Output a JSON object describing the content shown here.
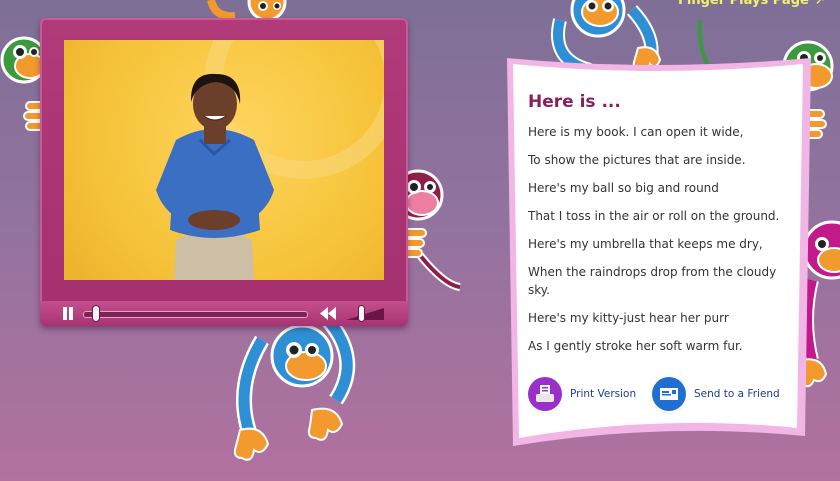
{
  "header": {
    "finger_plays_link": "Finger Plays Page"
  },
  "card": {
    "title": "Here is ...",
    "lines": [
      "Here is my book. I can open it wide,",
      "To show the pictures that are inside.",
      "Here's my ball so big and round",
      "That I toss in the air or roll on the ground.",
      "Here's my umbrella that keeps me dry,",
      "When the raindrops drop from the cloudy sky.",
      "Here's my kitty-just hear her purr",
      "As I gently stroke her soft warm fur."
    ],
    "actions": {
      "print_label": "Print Version",
      "send_label": "Send to a Friend"
    }
  },
  "player": {
    "progress": 0.06,
    "volume": 0.35
  },
  "colors": {
    "title": "#8b1f5e",
    "player_frame": "#a5306f",
    "link": "#1f3b8f",
    "top_link": "#f3f06a"
  },
  "icons": [
    "pause-icon",
    "rewind-icon",
    "volume-icon",
    "printer-icon",
    "envelope-icon",
    "arrow-right-icon"
  ]
}
